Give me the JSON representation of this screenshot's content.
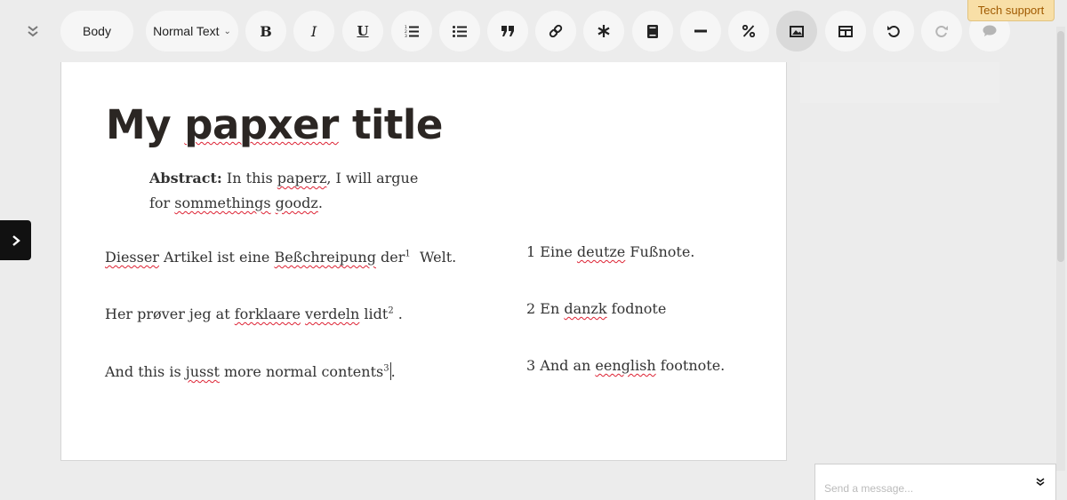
{
  "toolbar": {
    "section_label": "Body",
    "style_label": "Normal Text",
    "bold_label": "B",
    "italic_label": "I",
    "underline_label": "U"
  },
  "tech_support": "Tech support",
  "document": {
    "title_parts": [
      "My ",
      "papxer",
      " title"
    ],
    "abstract_label": "Abstract:",
    "abstract_parts": [
      " In this ",
      "paperz",
      ", I will argue for ",
      "sommethings",
      " ",
      "goodz",
      "."
    ],
    "paragraphs": [
      {
        "parts": [
          "Diesser",
          " Artikel ist eine ",
          "Beßchreipung",
          " der"
        ],
        "sup": "1",
        "tail": "  Welt."
      },
      {
        "parts": [
          "Her prøver jeg at ",
          "forklaare",
          " ",
          "verdeln",
          " lidt"
        ],
        "sup": "2",
        "tail": " ."
      },
      {
        "parts": [
          "And this is ",
          "jusst",
          " more normal contents"
        ],
        "sup": "3",
        "tail": "."
      }
    ],
    "footnotes": [
      {
        "parts": [
          "1 Eine ",
          "deutze",
          " Fußnote."
        ]
      },
      {
        "parts": [
          "2 En ",
          "danzk",
          " fodnote"
        ]
      },
      {
        "parts": [
          "3 And an ",
          "eenglish",
          " footnote."
        ]
      }
    ]
  },
  "chat": {
    "placeholder": "Send a message..."
  },
  "icons": {
    "collapse": "double-chevron-down-icon",
    "ordered_list": "ordered-list-icon",
    "bullet_list": "bullet-list-icon",
    "quote": "quote-icon",
    "link": "link-icon",
    "asterisk": "asterisk-icon",
    "citation": "book-icon",
    "horizontal_rule": "horizontal-rule-icon",
    "percent": "percent-icon",
    "figure": "image-icon",
    "table": "table-icon",
    "undo": "undo-icon",
    "redo": "redo-icon",
    "comment": "comment-icon",
    "sidebar_toggle": "chevron-right-icon"
  },
  "colors": {
    "background": "#ececec",
    "paper": "#ffffff",
    "pill": "#f6f6f6",
    "active_pill": "#d9d9d9",
    "tech_support_bg": "#f8dfa7",
    "tech_support_text": "#a05a00",
    "spellcheck": "#dd2233"
  }
}
